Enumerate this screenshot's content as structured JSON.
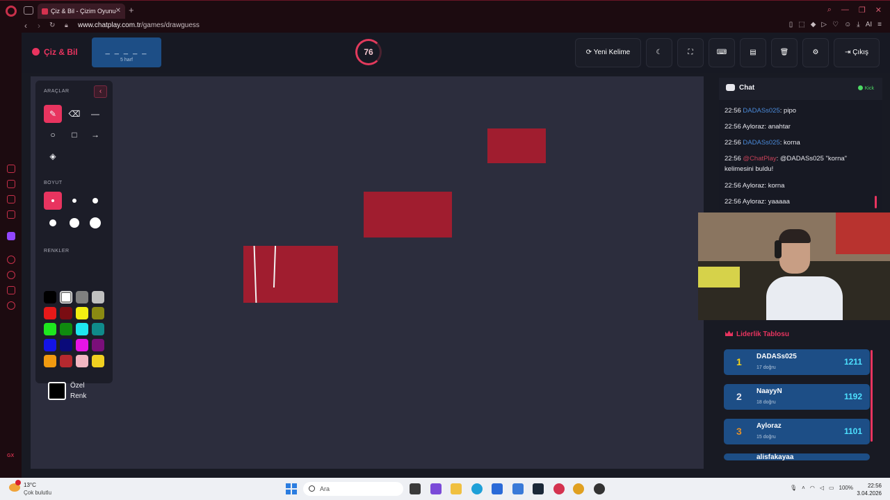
{
  "browser": {
    "tab_title": "Çiz & Bil - Çizim Oyunu",
    "url_host": "www.chatplay.com.tr",
    "url_path": "/games/drawguess",
    "ai_label": "AI"
  },
  "header": {
    "logo": "Çiz & Bil",
    "word_mask": "_ _ _ _ _",
    "word_length": "5 harf",
    "timer": "76",
    "new_word_label": "Yeni Kelime",
    "exit_label": "Çıkış"
  },
  "tools": {
    "tools_title": "ARAÇLAR",
    "size_title": "BOYUT",
    "colors_title": "RENKLER",
    "custom_color_label": "Özel Renk",
    "colors": [
      "#000000",
      "#ffffff",
      "#808080",
      "#c0c0c0",
      "#e61919",
      "#7a0d12",
      "#f2ee12",
      "#8a8a12",
      "#1ee61e",
      "#0f8a0f",
      "#1ee6f0",
      "#0f8a8a",
      "#1414e6",
      "#0a0a7a",
      "#e614e6",
      "#7a0f7a",
      "#f09a10",
      "#b5292f",
      "#f2b7c3",
      "#f0d020"
    ]
  },
  "chat": {
    "title": "Chat",
    "platform": "Kick",
    "messages": [
      {
        "time": "22:56",
        "user": "DADASs025",
        "user_style": "blue",
        "text": ": pipo"
      },
      {
        "time": "22:56",
        "user": "Ayloraz",
        "user_style": "plain",
        "text": ": anahtar"
      },
      {
        "time": "22:56",
        "user": "DADASs025",
        "user_style": "blue",
        "text": ": korna"
      },
      {
        "time": "22:56",
        "user": "@ChatPlay",
        "user_style": "red",
        "text": ": @DADASs025 \"korna\" kelimesini buldu!"
      },
      {
        "time": "22:56",
        "user": "Ayloraz",
        "user_style": "plain",
        "text": ": korna"
      },
      {
        "time": "22:56",
        "user": "Ayloraz",
        "user_style": "plain",
        "text": ": yaaaaa"
      }
    ]
  },
  "leaderboard": {
    "title": "Liderlik Tablosu",
    "rows": [
      {
        "rank": "1",
        "name": "DADASs025",
        "sub": "17 doğru",
        "score": "1211",
        "rank_color": "#f5d21a"
      },
      {
        "rank": "2",
        "name": "NaayyN",
        "sub": "18 doğru",
        "score": "1192",
        "rank_color": "#e6e6ee"
      },
      {
        "rank": "3",
        "name": "Ayloraz",
        "sub": "15 doğru",
        "score": "1101",
        "rank_color": "#e0902a"
      },
      {
        "rank": "",
        "name": "alisfakayaa",
        "sub": "",
        "score": "",
        "rank_color": "#e6e6ee"
      }
    ]
  },
  "taskbar": {
    "temperature": "13°C",
    "weather": "Çok bulutlu",
    "search_placeholder": "Ara",
    "battery": "100%",
    "time": "22:56",
    "date": "3.04.2026"
  }
}
